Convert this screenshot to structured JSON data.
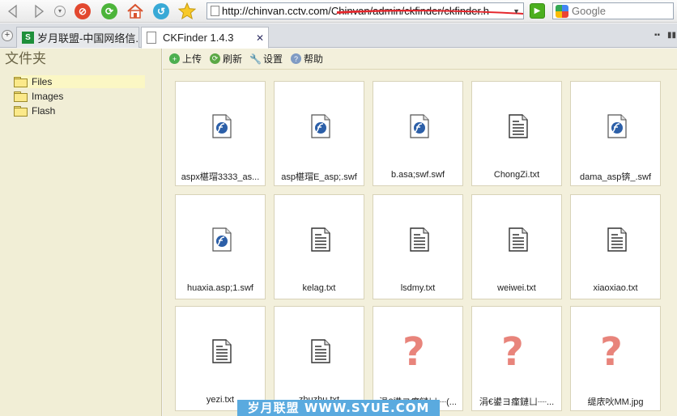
{
  "browser": {
    "address": "http://chinvan.cctv.com/Chinvan/admin/ckfinder/ckfinder.html",
    "search_placeholder": "Google",
    "tabs": [
      {
        "label": "岁月联盟-中国网络信..."
      },
      {
        "label": "CKFinder 1.4.3"
      }
    ]
  },
  "sidebar": {
    "header": "文件夹",
    "folders": [
      {
        "label": "Files",
        "selected": true
      },
      {
        "label": "Images",
        "selected": false
      },
      {
        "label": "Flash",
        "selected": false
      }
    ]
  },
  "toolbar": {
    "upload": "上传",
    "refresh": "刷新",
    "settings": "设置",
    "help": "帮助"
  },
  "files": [
    {
      "name": "aspx椹瑁3333_as...",
      "icon": "flash-file-icon"
    },
    {
      "name": "asp椹瑁E_asp;.swf",
      "icon": "flash-file-icon"
    },
    {
      "name": "b.asa;swf.swf",
      "icon": "flash-file-icon"
    },
    {
      "name": "ChongZi.txt",
      "icon": "text-file-icon"
    },
    {
      "name": "dama_asp锛_.swf",
      "icon": "flash-file-icon"
    },
    {
      "name": "huaxia.asp;1.swf",
      "icon": "flash-file-icon"
    },
    {
      "name": "kelag.txt",
      "icon": "text-file-icon"
    },
    {
      "name": "lsdmy.txt",
      "icon": "text-file-icon"
    },
    {
      "name": "weiwei.txt",
      "icon": "text-file-icon"
    },
    {
      "name": "xiaoxiao.txt",
      "icon": "text-file-icon"
    },
    {
      "name": "yezi.txt",
      "icon": "text-file-icon"
    },
    {
      "name": "zhuzhu.txt",
      "icon": "text-file-icon"
    },
    {
      "name": "涓€鍙ヨ瘽鏈ㄩ┈(...",
      "icon": "unknown-file-icon"
    },
    {
      "name": "涓€鍙ヨ瘽鏈ㄩ┈...",
      "icon": "unknown-file-icon"
    },
    {
      "name": "缇庡吙MM.jpg",
      "icon": "unknown-file-icon"
    }
  ],
  "watermark": "岁月联盟 WWW.SYUE.COM"
}
